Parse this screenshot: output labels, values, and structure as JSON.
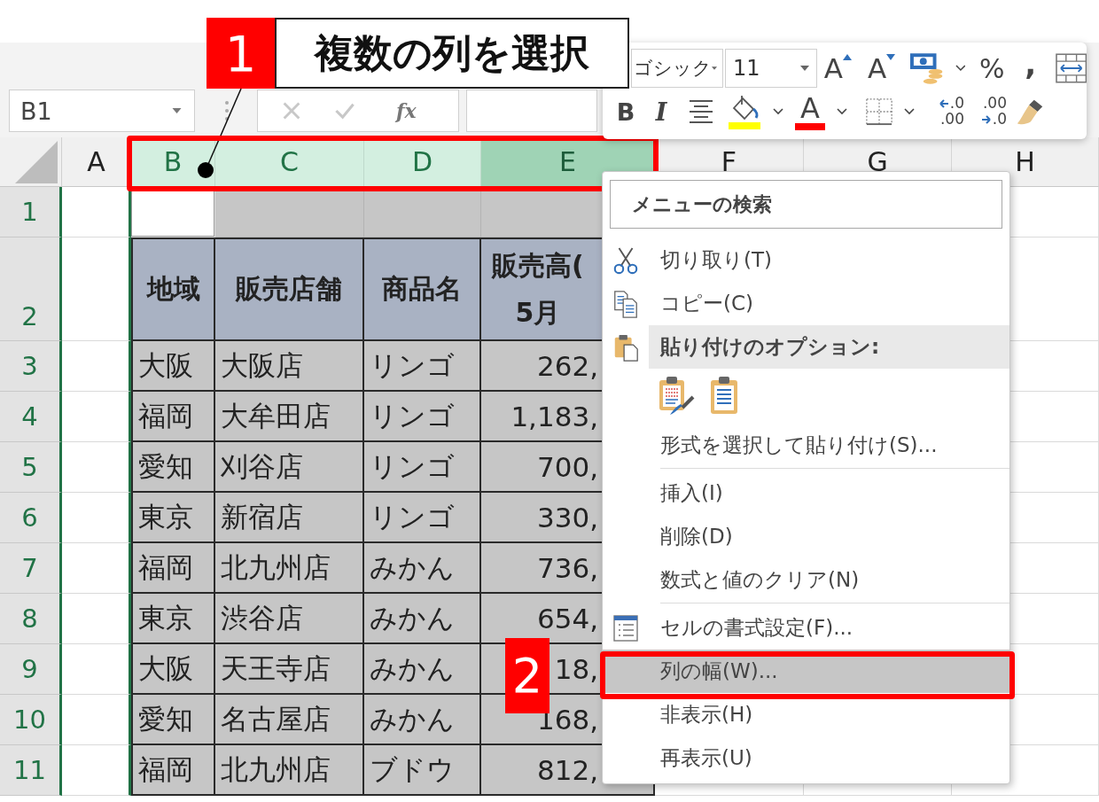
{
  "formula_bar": {
    "name_box": "B1",
    "function_label": "fx"
  },
  "sheet": {
    "columns": [
      {
        "label": "A",
        "selected": false,
        "hovered": false
      },
      {
        "label": "B",
        "selected": true,
        "hovered": false
      },
      {
        "label": "C",
        "selected": true,
        "hovered": false
      },
      {
        "label": "D",
        "selected": true,
        "hovered": false
      },
      {
        "label": "E",
        "selected": true,
        "hovered": true
      },
      {
        "label": "F",
        "selected": false,
        "hovered": false
      },
      {
        "label": "G",
        "selected": false,
        "hovered": false
      },
      {
        "label": "H",
        "selected": false,
        "hovered": false
      }
    ],
    "rows": [
      {
        "number": "1",
        "kind": "blank",
        "cells": [
          {
            "active": false
          },
          {
            "active": true
          },
          {
            "active": false
          },
          {
            "active": false
          },
          {
            "active": false
          }
        ]
      },
      {
        "number": "2",
        "kind": "header",
        "cells": [
          "",
          "地域",
          "販売店舗",
          "商品名",
          "販売高(\n5月"
        ]
      },
      {
        "number": "3",
        "kind": "data",
        "cells": [
          "",
          "大阪",
          "大阪店",
          "リンゴ",
          "262,"
        ]
      },
      {
        "number": "4",
        "kind": "data",
        "cells": [
          "",
          "福岡",
          "大牟田店",
          "リンゴ",
          "1,183,"
        ]
      },
      {
        "number": "5",
        "kind": "data",
        "cells": [
          "",
          "愛知",
          "刈谷店",
          "リンゴ",
          "700,"
        ]
      },
      {
        "number": "6",
        "kind": "data",
        "cells": [
          "",
          "東京",
          "新宿店",
          "リンゴ",
          "330,"
        ]
      },
      {
        "number": "7",
        "kind": "data",
        "cells": [
          "",
          "福岡",
          "北九州店",
          "みかん",
          "736,"
        ]
      },
      {
        "number": "8",
        "kind": "data",
        "cells": [
          "",
          "東京",
          "渋谷店",
          "みかん",
          "654,"
        ]
      },
      {
        "number": "9",
        "kind": "data",
        "cells": [
          "",
          "大阪",
          "天王寺店",
          "みかん",
          "18,"
        ]
      },
      {
        "number": "10",
        "kind": "data",
        "cells": [
          "",
          "愛知",
          "名古屋店",
          "みかん",
          "168,"
        ]
      },
      {
        "number": "11",
        "kind": "data",
        "cells": [
          "",
          "福岡",
          "北九州店",
          "ブドウ",
          "812,"
        ]
      }
    ]
  },
  "mini_toolbar": {
    "font_name": "ゴシック",
    "font_size": "11",
    "row1": [
      {
        "kind": "grow-font",
        "label": "A"
      },
      {
        "kind": "shrink-font",
        "label": "A"
      },
      {
        "kind": "currency"
      },
      {
        "kind": "dropdown"
      },
      {
        "kind": "percent",
        "label": "%"
      },
      {
        "kind": "comma",
        "label": ","
      },
      {
        "kind": "autofit"
      }
    ],
    "row2": [
      {
        "kind": "bold",
        "label": "B"
      },
      {
        "kind": "italic",
        "label": "I"
      },
      {
        "kind": "center"
      },
      {
        "kind": "fill-color",
        "color": "#ffff00"
      },
      {
        "kind": "dropdown"
      },
      {
        "kind": "font-color",
        "label": "A",
        "color": "#ff0000"
      },
      {
        "kind": "dropdown"
      },
      {
        "kind": "borders"
      },
      {
        "kind": "dropdown"
      },
      {
        "kind": "increase-decimal",
        "top": ".0",
        "bottom": ".00"
      },
      {
        "kind": "decrease-decimal",
        "top": ".00",
        "bottom": ".0"
      },
      {
        "kind": "format-painter"
      }
    ]
  },
  "context_menu": {
    "placeholder": "メニューの検索",
    "items": [
      {
        "kind": "cut",
        "label": "切り取り(T)",
        "highlighted": false
      },
      {
        "kind": "copy",
        "label": "コピー(C)",
        "highlighted": false
      },
      {
        "kind": "heading",
        "label": "貼り付けのオプション:",
        "highlighted": false
      },
      {
        "kind": "paste-buttons",
        "highlighted": false
      },
      {
        "kind": "plain",
        "label": "形式を選択して貼り付け(S)...",
        "highlighted": false
      },
      {
        "kind": "plain",
        "label": "挿入(I)",
        "divided": true,
        "highlighted": false
      },
      {
        "kind": "plain",
        "label": "削除(D)",
        "highlighted": false
      },
      {
        "kind": "plain",
        "label": "数式と値のクリア(N)",
        "highlighted": false
      },
      {
        "kind": "format",
        "label": "セルの書式設定(F)...",
        "divided": true,
        "highlighted": false
      },
      {
        "kind": "plain",
        "label": "列の幅(W)...",
        "highlighted": true
      },
      {
        "kind": "plain",
        "label": "非表示(H)",
        "highlighted": false
      },
      {
        "kind": "plain",
        "label": "再表示(U)",
        "highlighted": false
      }
    ]
  },
  "callouts": [
    {
      "number": "1",
      "text": "複数の列を選択"
    },
    {
      "number": "2"
    }
  ]
}
